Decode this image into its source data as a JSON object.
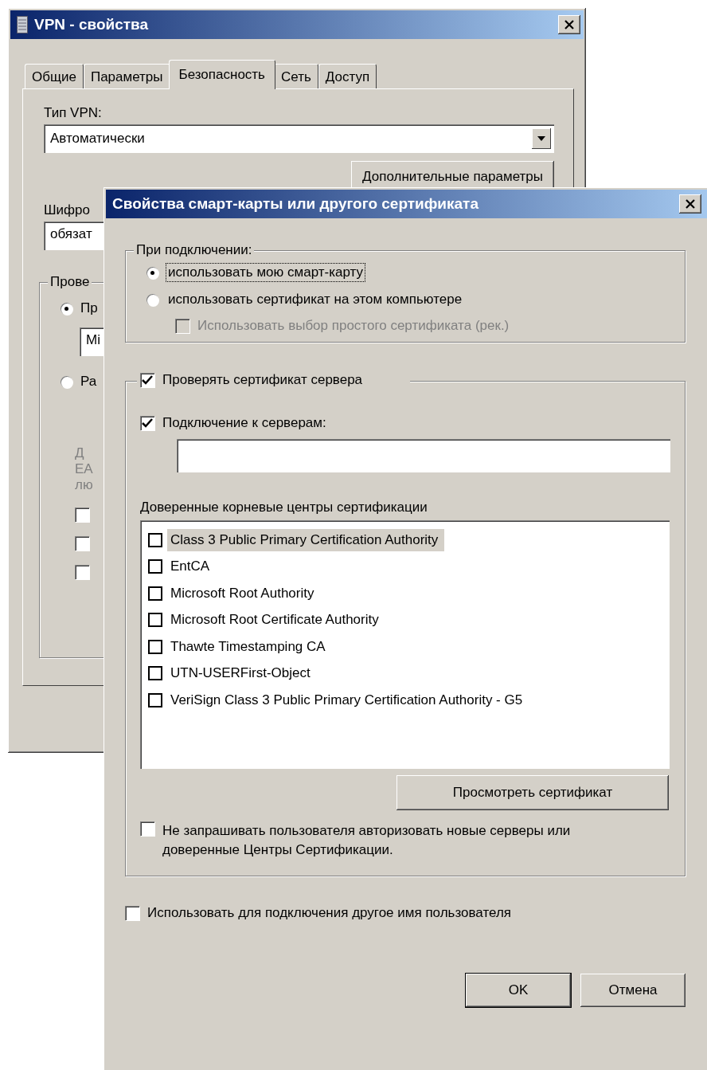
{
  "back_window": {
    "title": "VPN - свойства",
    "tabs": [
      {
        "label": "Общие",
        "selected": false
      },
      {
        "label": "Параметры",
        "selected": false
      },
      {
        "label": "Безопасность",
        "selected": true
      },
      {
        "label": "Сеть",
        "selected": false
      },
      {
        "label": "Доступ",
        "selected": false
      }
    ],
    "vpn_type_label": "Тип VPN:",
    "vpn_type_value": "Автоматически",
    "advanced_button": "Дополнительные параметры",
    "encryption_label": "Шифро",
    "encryption_value": "обязат",
    "auth_group_label": "Прове",
    "radios": [
      {
        "label": "Пр",
        "selected": true
      },
      {
        "label": "Ра",
        "selected": false
      }
    ],
    "protocol_value": "Mi",
    "hint_lines": [
      "Д",
      "EA",
      "лю"
    ],
    "checkboxes": [
      {
        "checked": false
      },
      {
        "checked": false
      },
      {
        "checked": false
      }
    ]
  },
  "dialog": {
    "title": "Свойства смарт-карты или другого сертификата",
    "connect_group": {
      "label": "При подключении:",
      "options": [
        {
          "label": "использовать мою смарт-карту",
          "selected": true,
          "focused": true
        },
        {
          "label": "использовать сертификат на этом компьютере",
          "selected": false,
          "focused": false
        }
      ],
      "simple_cert": {
        "label": "Использовать выбор простого сертификата (рек.)",
        "checked": false,
        "disabled": true
      }
    },
    "verify_server": {
      "label": "Проверять сертификат сервера",
      "checked": true
    },
    "connect_to_servers": {
      "label": "Подключение к серверам:",
      "checked": true
    },
    "trusted_roots": {
      "label": "Доверенные корневые центры сертификации",
      "items": [
        {
          "label": "Class 3 Public Primary Certification Authority",
          "checked": false,
          "selected": true
        },
        {
          "label": "EntCA",
          "checked": false,
          "selected": false
        },
        {
          "label": "Microsoft Root Authority",
          "checked": false,
          "selected": false
        },
        {
          "label": "Microsoft Root Certificate Authority",
          "checked": false,
          "selected": false
        },
        {
          "label": "Thawte Timestamping CA",
          "checked": false,
          "selected": false
        },
        {
          "label": "UTN-USERFirst-Object",
          "checked": false,
          "selected": false
        },
        {
          "label": "VeriSign Class 3 Public Primary Certification Authority - G5",
          "checked": false,
          "selected": false
        }
      ]
    },
    "view_cert_button": "Просмотреть сертификат",
    "dont_prompt": {
      "label": "Не запрашивать пользователя авторизовать новые серверы или доверенные Центры Сертификации.",
      "checked": false
    },
    "other_user": {
      "label": "Использовать для подключения другое имя пользователя",
      "checked": false
    },
    "buttons": [
      "OK",
      "Отмена"
    ]
  }
}
